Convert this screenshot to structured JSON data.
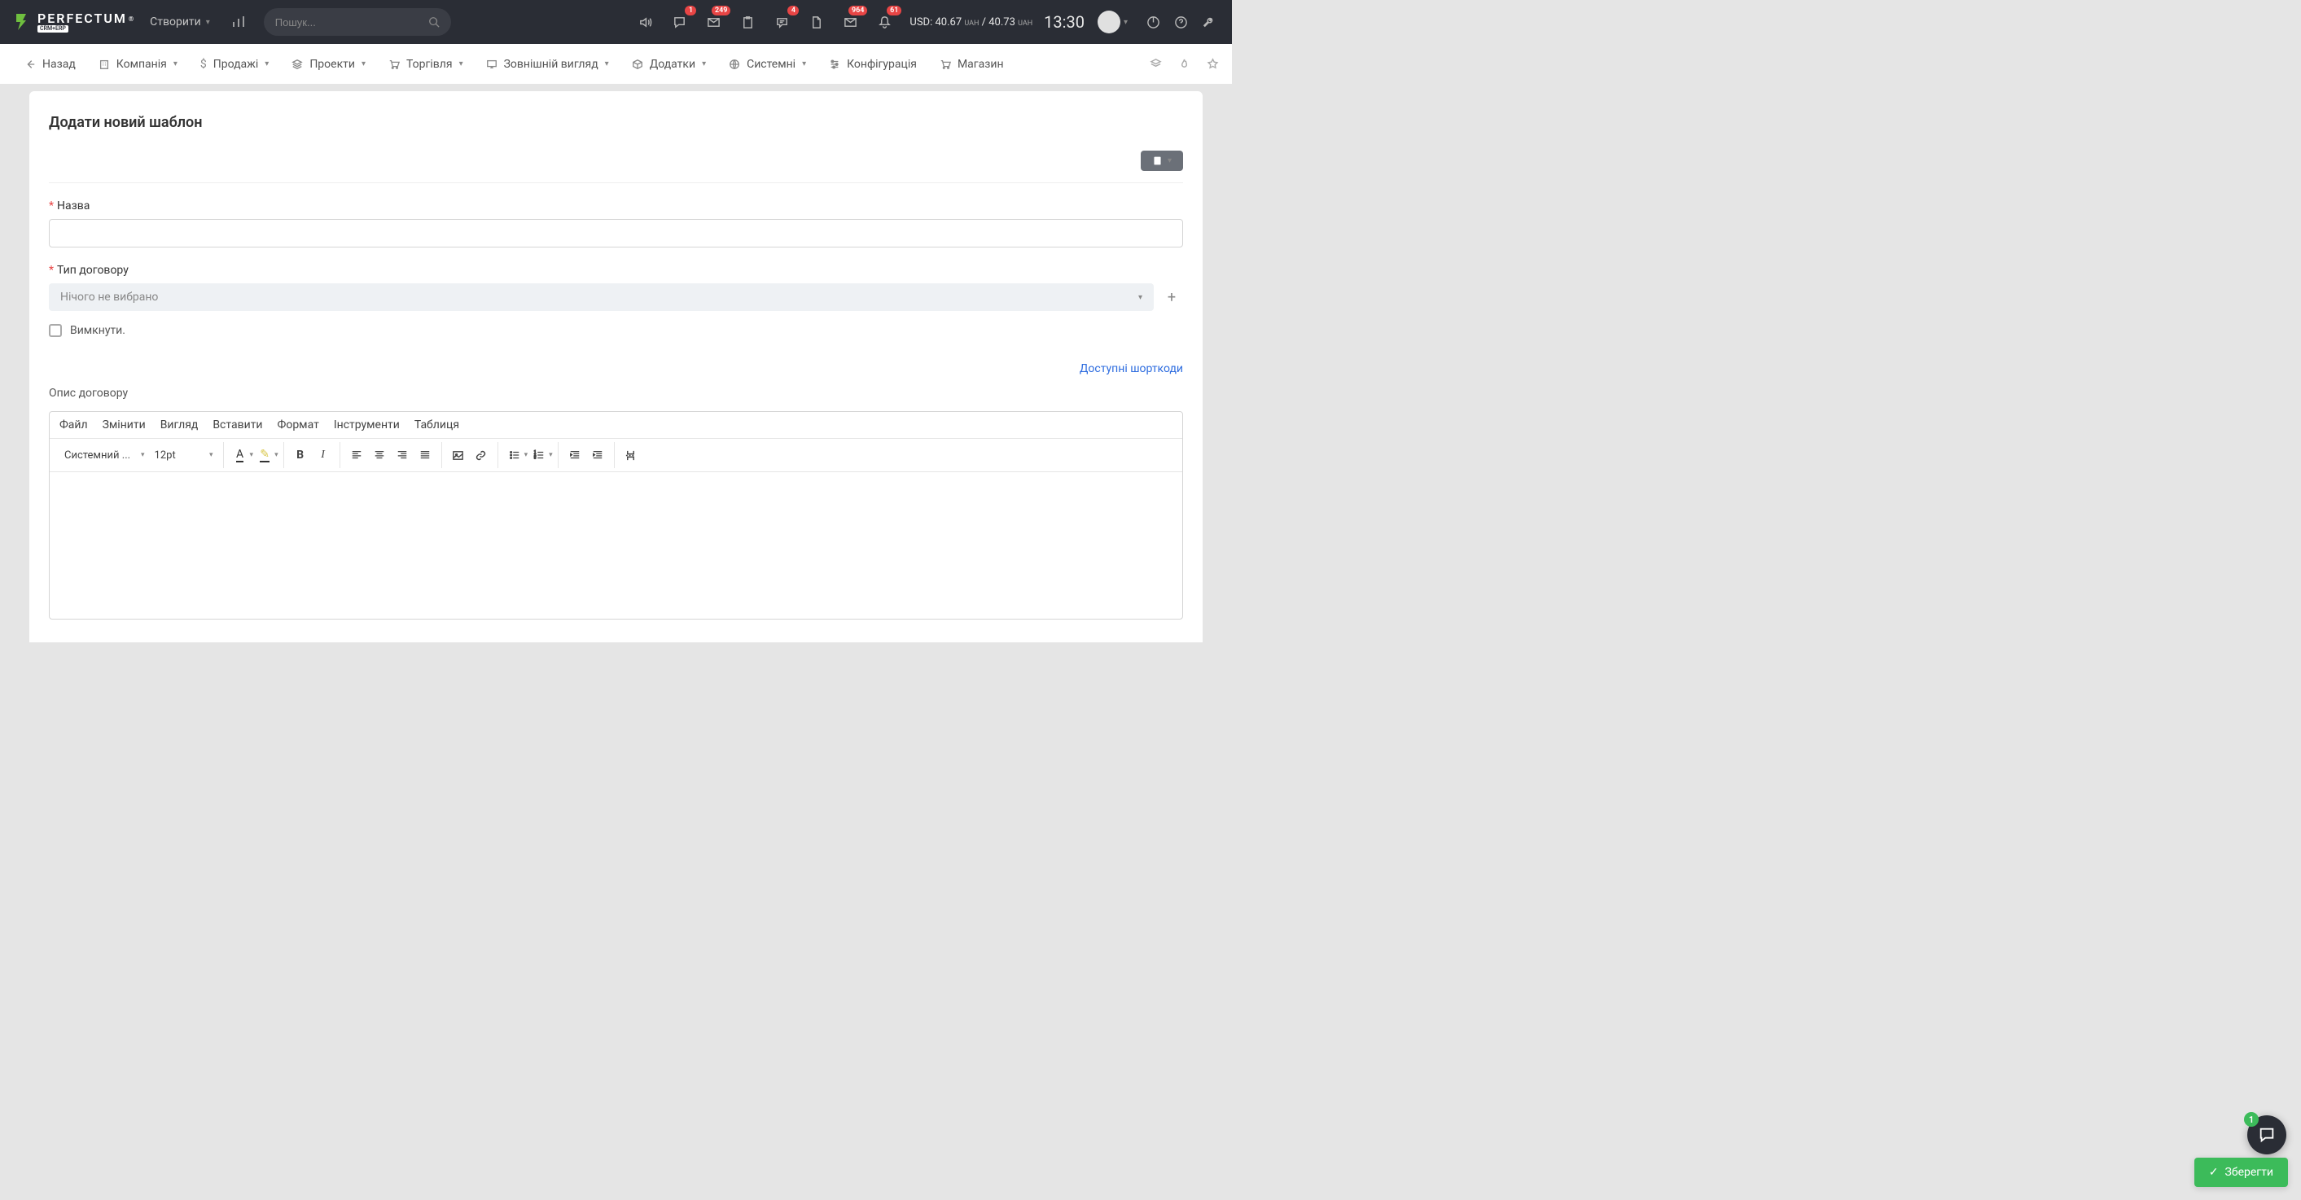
{
  "topbar": {
    "logo_main": "PERFECTUM",
    "logo_sub": "CRM+ERP",
    "logo_reg": "®",
    "create_label": "Створити",
    "search_placeholder": "Пошук...",
    "badges": {
      "chat": "1",
      "mail": "249",
      "msg": "4",
      "inbox": "964",
      "bell": "61"
    },
    "currency_prefix": "USD:",
    "currency_buy": "40.67",
    "currency_unit": "UAH",
    "currency_sep": "/",
    "currency_sell": "40.73",
    "time": "13:30"
  },
  "nav": {
    "back": "Назад",
    "items": [
      {
        "label": "Компанія"
      },
      {
        "label": "Продажі"
      },
      {
        "label": "Проекти"
      },
      {
        "label": "Торгівля"
      },
      {
        "label": "Зовнішній вигляд"
      },
      {
        "label": "Додатки"
      },
      {
        "label": "Системні"
      },
      {
        "label": "Конфігурація"
      },
      {
        "label": "Магазин"
      }
    ]
  },
  "page": {
    "title": "Додати новий шаблон",
    "name_label": "Назва",
    "type_label": "Тип договору",
    "type_placeholder": "Нічого не вибрано",
    "disable_label": "Вимкнути.",
    "shortcodes_link": "Доступні шорткоди",
    "desc_label": "Опис договору"
  },
  "editor": {
    "menu": [
      "Файл",
      "Змінити",
      "Вигляд",
      "Вставити",
      "Формат",
      "Інструменти",
      "Таблиця"
    ],
    "font_family": "Системний ...",
    "font_size": "12pt"
  },
  "save_label": "Зберегти",
  "chat_badge": "1"
}
